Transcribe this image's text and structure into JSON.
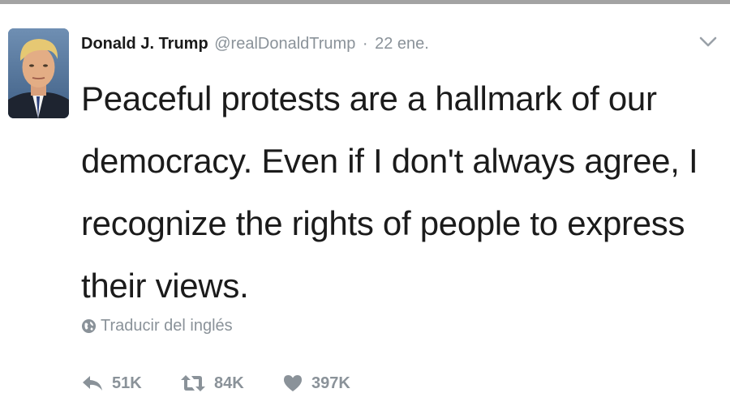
{
  "tweet": {
    "author": {
      "display_name": "Donald J. Trump",
      "screen_name": "@realDonaldTrump"
    },
    "separator": "·",
    "timestamp": "22 ene.",
    "text": "Peaceful protests are a hallmark of our democracy. Even if I don't always agree, I recognize the rights of people to express their views.",
    "translate_label": "Traducir del inglés",
    "actions": {
      "reply_count": "51K",
      "retweet_count": "84K",
      "like_count": "397K"
    }
  },
  "icons": {
    "caret": "chevron-down-icon",
    "translate": "globe-icon",
    "reply": "reply-icon",
    "retweet": "retweet-icon",
    "like": "heart-icon"
  },
  "colors": {
    "text": "#1b1b1b",
    "secondary": "#8a9299",
    "top_bar": "#a3a3a3"
  }
}
